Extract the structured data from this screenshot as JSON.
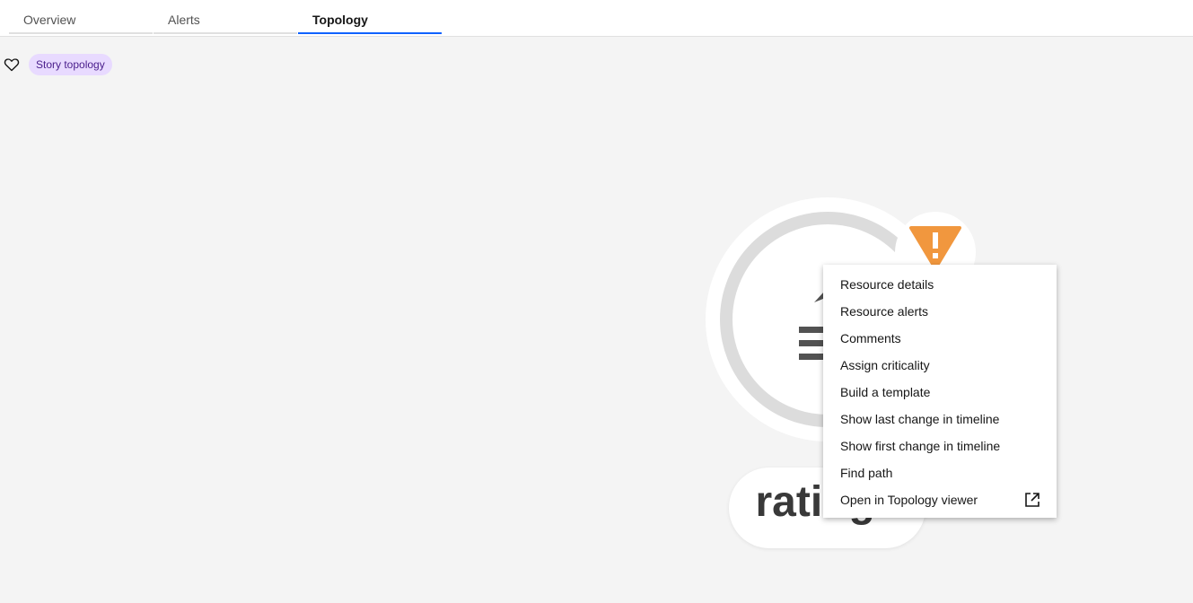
{
  "tabs": [
    {
      "label": "Overview",
      "active": false
    },
    {
      "label": "Alerts",
      "active": false
    },
    {
      "label": "Topology",
      "active": true
    }
  ],
  "toolbar": {
    "favorite_icon": "heart-outline-icon",
    "tag_label": "Story topology"
  },
  "topology": {
    "node": {
      "label": "ratings",
      "status_icon": "warning-triangle-icon",
      "status_color": "#f1973e"
    }
  },
  "context_menu": {
    "items": [
      {
        "label": "Resource details"
      },
      {
        "label": "Resource alerts"
      },
      {
        "label": "Comments"
      },
      {
        "label": "Assign criticality"
      },
      {
        "label": "Build a template"
      },
      {
        "label": "Show last change in timeline"
      },
      {
        "label": "Show first change in timeline"
      },
      {
        "label": "Find path"
      },
      {
        "label": "Open in Topology viewer",
        "icon": "launch-icon"
      }
    ]
  },
  "colors": {
    "accent": "#0f62fe",
    "tag_bg": "#e8daff",
    "tag_text": "#491d8b",
    "warning": "#f1973e"
  }
}
